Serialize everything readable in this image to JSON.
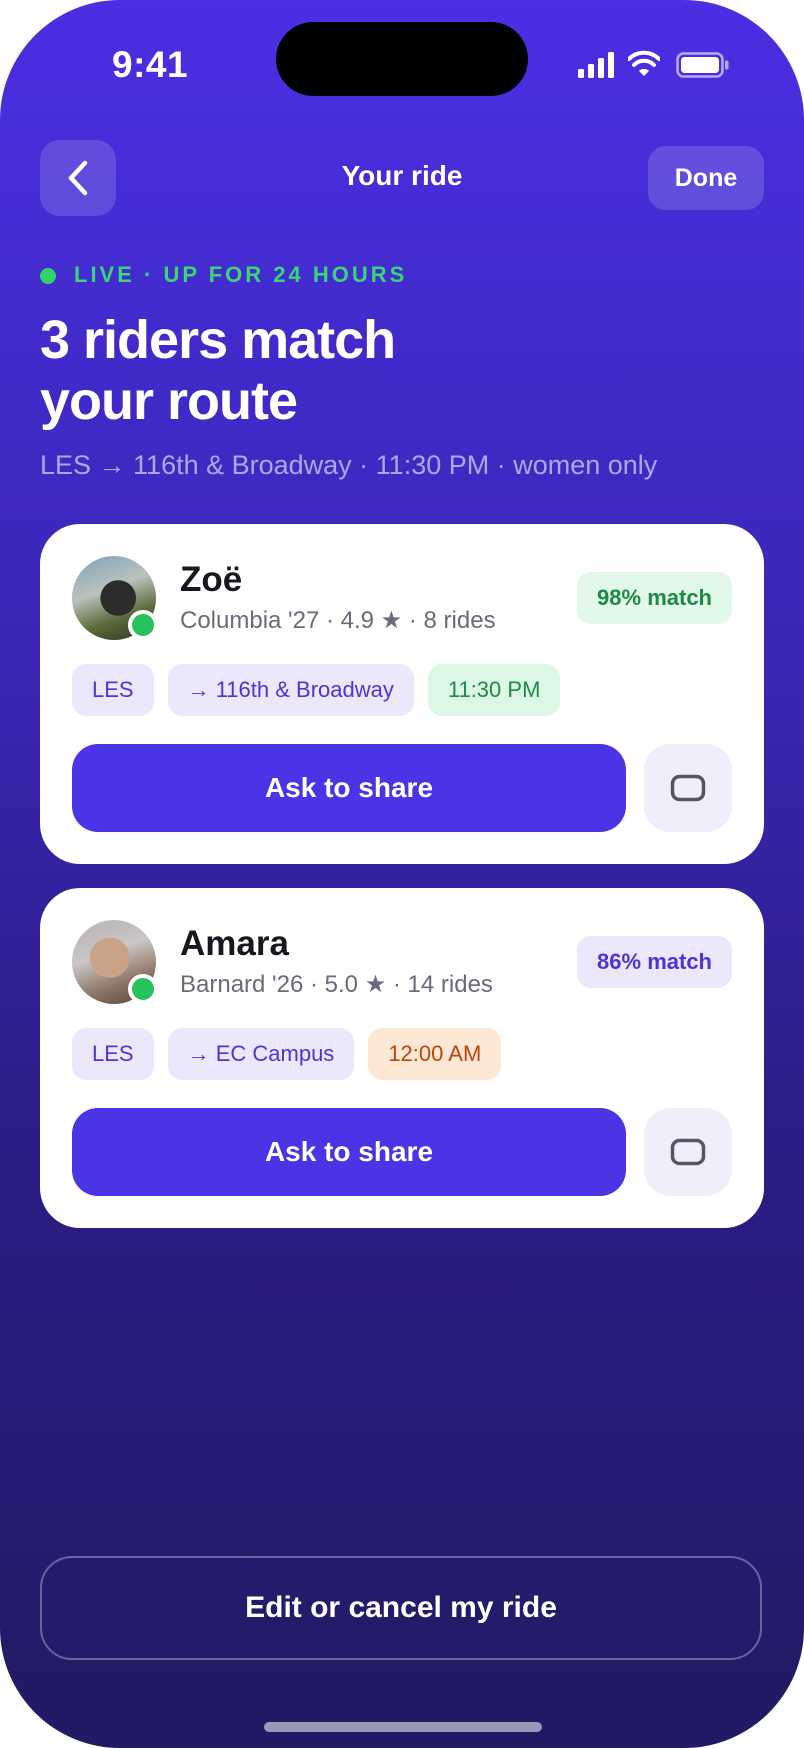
{
  "status_bar": {
    "time": "9:41"
  },
  "header": {
    "title": "Your ride",
    "done_label": "Done"
  },
  "hero": {
    "live_label": "LIVE · UP FOR 24 HOURS",
    "headline_line1": "3 riders match",
    "headline_line2": "your route",
    "route_summary": "LES → 116th & Broadway · 11:30 PM · women only"
  },
  "riders": [
    {
      "name": "Zoë",
      "meta": "Columbia '27 · 4.9 ★ · 8 rides",
      "match": "98% match",
      "match_bg": "#e2f8e8",
      "match_color": "#1c8a45",
      "pickup": "LES",
      "destination": "→ 116th & Broadway",
      "time": "11:30 PM",
      "time_bg": "#dcf7e5",
      "time_color": "#1f8a4a",
      "action_label": "Ask to share"
    },
    {
      "name": "Amara",
      "meta": "Barnard '26 · 5.0 ★ · 14 rides",
      "match": "86% match",
      "match_bg": "#ebe8fb",
      "match_color": "#4a35d8",
      "pickup": "LES",
      "destination": "→ EC Campus",
      "time": "12:00 AM",
      "time_bg": "#fde8d6",
      "time_color": "#c2410c",
      "action_label": "Ask to share"
    }
  ],
  "footer": {
    "edit_label": "Edit or cancel my ride"
  },
  "colors": {
    "accent": "#4b33e6",
    "live_green": "#37d875",
    "online_green": "#27c25c"
  }
}
